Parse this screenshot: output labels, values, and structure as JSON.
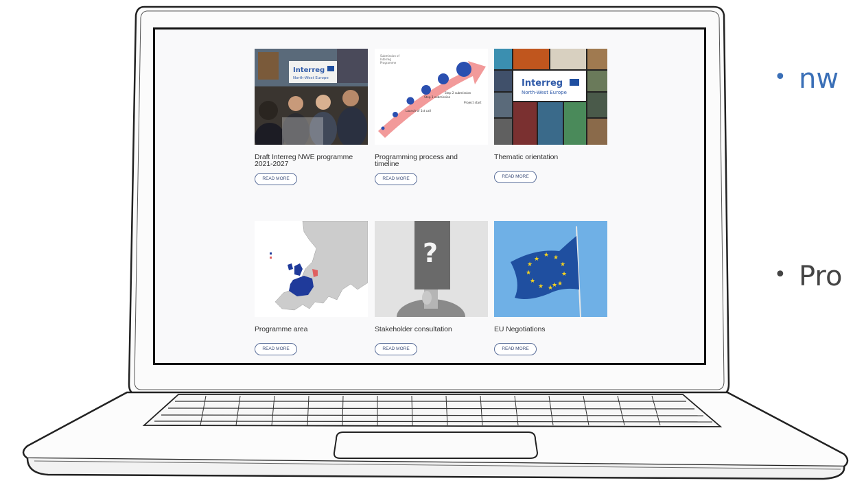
{
  "slide": {
    "bullets": [
      {
        "text": "nw",
        "color": "#3a6fb7"
      },
      {
        "text": "Pro",
        "color": "#444444"
      }
    ]
  },
  "screen": {
    "cards": [
      {
        "title_line1": "Draft Interreg NWE programme",
        "title_line2": "2021-2027",
        "button": "READ MORE",
        "thumb": "conference-photo",
        "logo_text": "Interreg",
        "logo_sub": "North-West Europe"
      },
      {
        "title_line1": "Programming process and",
        "title_line2": "timeline",
        "button": "READ MORE",
        "thumb": "timeline-arrow",
        "labels": [
          "Launch of 1st call",
          "Step 1 submission",
          "Step 2 submission",
          "Project start"
        ]
      },
      {
        "title_line1": "Thematic orientation",
        "title_line2": "",
        "button": "READ MORE",
        "thumb": "collage",
        "logo_text": "Interreg",
        "logo_sub": "North-West Europe"
      },
      {
        "title_line1": "Programme area",
        "title_line2": "",
        "button": "READ MORE",
        "thumb": "europe-map"
      },
      {
        "title_line1": "Stakeholder consultation",
        "title_line2": "",
        "button": "READ MORE",
        "thumb": "question-person"
      },
      {
        "title_line1": "EU Negotiations",
        "title_line2": "",
        "button": "READ MORE",
        "thumb": "eu-flag"
      }
    ]
  },
  "colors": {
    "accent": "#3a6fb7",
    "button_border": "#5b6f9a",
    "eu_blue": "#1f4fa0",
    "eu_gold": "#f5d21f"
  }
}
